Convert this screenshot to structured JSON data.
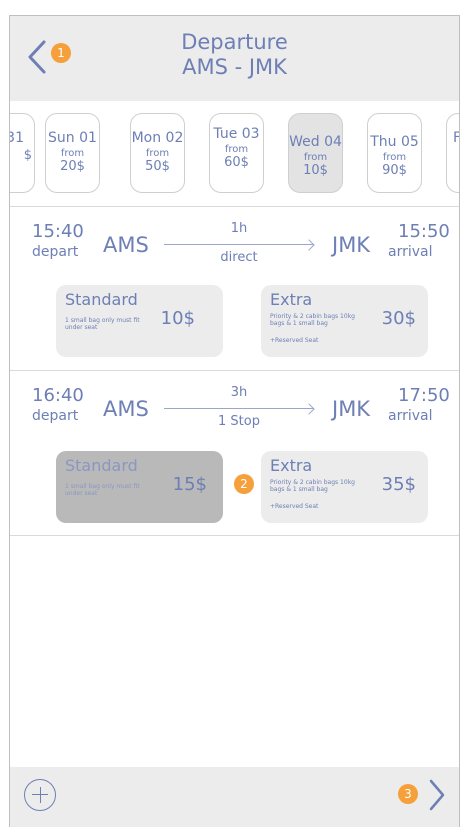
{
  "header": {
    "title": "Departure",
    "route": "AMS - JMK",
    "back_badge": "1"
  },
  "dates": [
    {
      "day": "31",
      "from": "",
      "price": "$"
    },
    {
      "day": "Sun 01",
      "from": "from",
      "price": "20$"
    },
    {
      "day": "Mon 02",
      "from": "from",
      "price": "50$"
    },
    {
      "day": "Tue 03",
      "from": "from",
      "price": "60$"
    },
    {
      "day": "Wed 04",
      "from": "from",
      "price": "10$"
    },
    {
      "day": "Thu 05",
      "from": "from",
      "price": "90$"
    },
    {
      "day": "F",
      "from": "",
      "price": ""
    }
  ],
  "flights": [
    {
      "depart_time": "15:40",
      "depart_label": "depart",
      "origin": "AMS",
      "duration": "1h",
      "stops": "direct",
      "destination": "JMK",
      "arrival_time": "15:50",
      "arrival_label": "arrival",
      "standard": {
        "name": "Standard",
        "desc": "1 small bag only must fit under seat",
        "price": "10$"
      },
      "extra": {
        "name": "Extra",
        "desc": "Priority & 2 cabin bags 10kg bags & 1 small bag",
        "price": "30$",
        "note": "+Reserved Seat"
      }
    },
    {
      "depart_time": "16:40",
      "depart_label": "depart",
      "origin": "AMS",
      "duration": "3h",
      "stops": "1 Stop",
      "destination": "JMK",
      "arrival_time": "17:50",
      "arrival_label": "arrival",
      "standard": {
        "name": "Standard",
        "desc": "1 small bag only must fit under seat",
        "price": "15$"
      },
      "extra": {
        "name": "Extra",
        "desc": "Priority & 2 cabin bags 10kg bags & 1 small bag",
        "price": "35$",
        "note": "+Reserved Seat"
      },
      "badge": "2"
    }
  ],
  "footer": {
    "next_badge": "3"
  },
  "colors": {
    "accent": "#6d7fb5",
    "badge": "#f5a03a",
    "panel": "#ececec",
    "selected": "#b9b9b9"
  }
}
